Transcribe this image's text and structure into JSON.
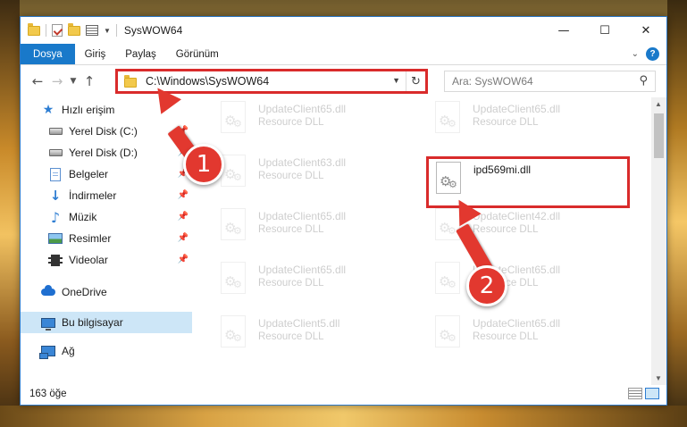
{
  "window": {
    "title": "SysWOW64",
    "controls": {
      "minimize": "—",
      "maximize": "☐",
      "close": "✕"
    }
  },
  "ribbon": {
    "tabs": [
      "Dosya",
      "Giriş",
      "Paylaş",
      "Görünüm"
    ],
    "help": "?"
  },
  "navbar": {
    "address": "C:\\Windows\\SysWOW64",
    "search_placeholder": "Ara: SysWOW64"
  },
  "sidebar": {
    "items": [
      {
        "label": "Hızlı erişim",
        "icon": "star-icon",
        "pinned": false
      },
      {
        "label": "Yerel Disk (C:)",
        "icon": "drive-icon",
        "pinned": true
      },
      {
        "label": "Yerel Disk (D:)",
        "icon": "drive-icon",
        "pinned": true
      },
      {
        "label": "Belgeler",
        "icon": "documents-icon",
        "pinned": true
      },
      {
        "label": "İndirmeler",
        "icon": "download-icon",
        "pinned": true
      },
      {
        "label": "Müzik",
        "icon": "music-icon",
        "pinned": true
      },
      {
        "label": "Resimler",
        "icon": "pictures-icon",
        "pinned": true
      },
      {
        "label": "Videolar",
        "icon": "videos-icon",
        "pinned": true
      },
      {
        "label": "OneDrive",
        "icon": "onedrive-icon",
        "pinned": false
      },
      {
        "label": "Bu bilgisayar",
        "icon": "computer-icon",
        "pinned": false,
        "selected": true
      },
      {
        "label": "Ağ",
        "icon": "network-icon",
        "pinned": false
      }
    ]
  },
  "files": [
    {
      "name": "UpdateClient65.dll",
      "type": "Resource DLL",
      "faded": true
    },
    {
      "name": "UpdateClient65.dll",
      "type": "Resource DLL",
      "faded": true
    },
    {
      "name": "UpdateClient63.dll",
      "type": "Resource DLL",
      "faded": true
    },
    {
      "name": "ipd569mi.dll",
      "type": "",
      "faded": false,
      "highlighted": true
    },
    {
      "name": "UpdateClient65.dll",
      "type": "Resource DLL",
      "faded": true
    },
    {
      "name": "UpdateClient42.dll",
      "type": "Resource DLL",
      "faded": true
    },
    {
      "name": "UpdateClient65.dll",
      "type": "Resource DLL",
      "faded": true
    },
    {
      "name": "UpdateClient65.dll",
      "type": "Resource DLL",
      "faded": true
    },
    {
      "name": "UpdateClient5.dll",
      "type": "Resource DLL",
      "faded": true
    },
    {
      "name": "UpdateClient65.dll",
      "type": "Resource DLL",
      "faded": true
    }
  ],
  "status": {
    "count": "163 öğe"
  },
  "annotations": {
    "step1": "1",
    "step2": "2",
    "color": "#e2382f"
  }
}
